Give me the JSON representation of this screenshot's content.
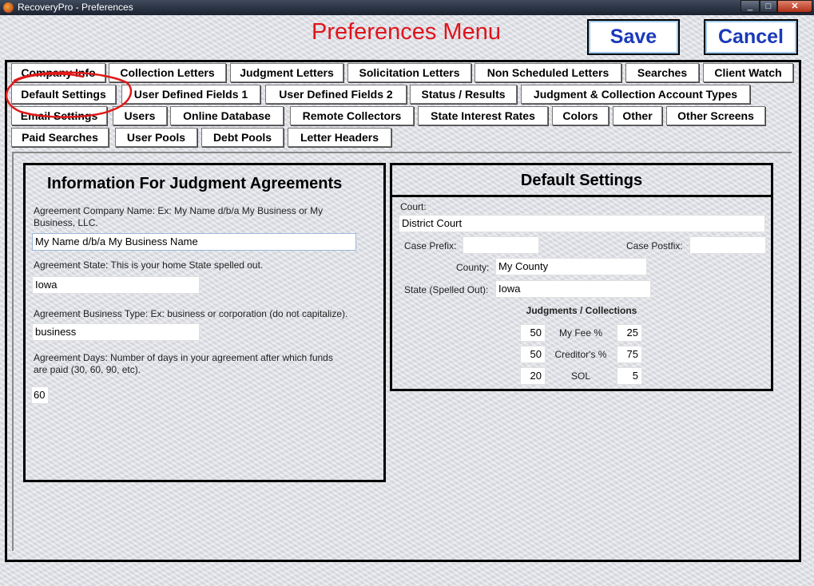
{
  "window": {
    "title": "RecoveryPro - Preferences",
    "min": "_",
    "max": "□",
    "close": "✕"
  },
  "icons": {
    "app": "app-icon",
    "min": "minimize-icon",
    "max": "maximize-icon",
    "close": "close-icon"
  },
  "heading": "Preferences Menu",
  "toolbar": {
    "save_label": "Save",
    "cancel_label": "Cancel"
  },
  "tabs": {
    "row1": [
      "Company Info",
      "Collection Letters",
      "Judgment Letters",
      "Solicitation Letters",
      "Non Scheduled Letters",
      "Searches",
      "Client Watch"
    ],
    "row2": [
      "Default Settings",
      "User Defined Fields 1",
      "User Defined Fields 2",
      "Status / Results",
      "Judgment & Collection Account Types"
    ],
    "row3": [
      "Email Settings",
      "Users",
      "Online Database",
      "Remote Collectors",
      "State Interest Rates",
      "Colors",
      "Other",
      "Other Screens"
    ],
    "row4": [
      "Paid Searches",
      "User Pools",
      "Debt Pools",
      "Letter Headers"
    ],
    "active": "Default Settings"
  },
  "judgment_info": {
    "title": "Information For Judgment Agreements",
    "company_label": "Agreement Company Name:  Ex: My Name d/b/a My Business or My Business, LLC.",
    "company_value": "My Name d/b/a My Business Name",
    "state_label": "Agreement State: This is your home State spelled out.",
    "state_value": "Iowa",
    "business_type_label": "Agreement Business Type: Ex: business or corporation (do not capitalize).",
    "business_type_value": "business",
    "days_label": "Agreement Days: Number of days in your agreement after which funds are paid (30, 60, 90, etc).",
    "days_value": "60"
  },
  "defaults": {
    "title": "Default Settings",
    "court_label": "Court:",
    "court_value": "District Court",
    "case_prefix_label": "Case Prefix:",
    "case_prefix_value": "",
    "case_postfix_label": "Case Postfix:",
    "case_postfix_value": "",
    "county_label": "County:",
    "county_value": "My County",
    "state_label": "State (Spelled Out):",
    "state_value": "Iowa",
    "jc_heading": "Judgments / Collections",
    "rows": [
      {
        "label": "My Fee %",
        "judgment": "50",
        "collection": "25"
      },
      {
        "label": "Creditor's %",
        "judgment": "50",
        "collection": "75"
      },
      {
        "label": "SOL",
        "judgment": "20",
        "collection": "5"
      }
    ]
  },
  "colors": {
    "heading_red": "#e0141c",
    "button_blue": "#1a3ab8",
    "annotation_red": "#e01818"
  }
}
